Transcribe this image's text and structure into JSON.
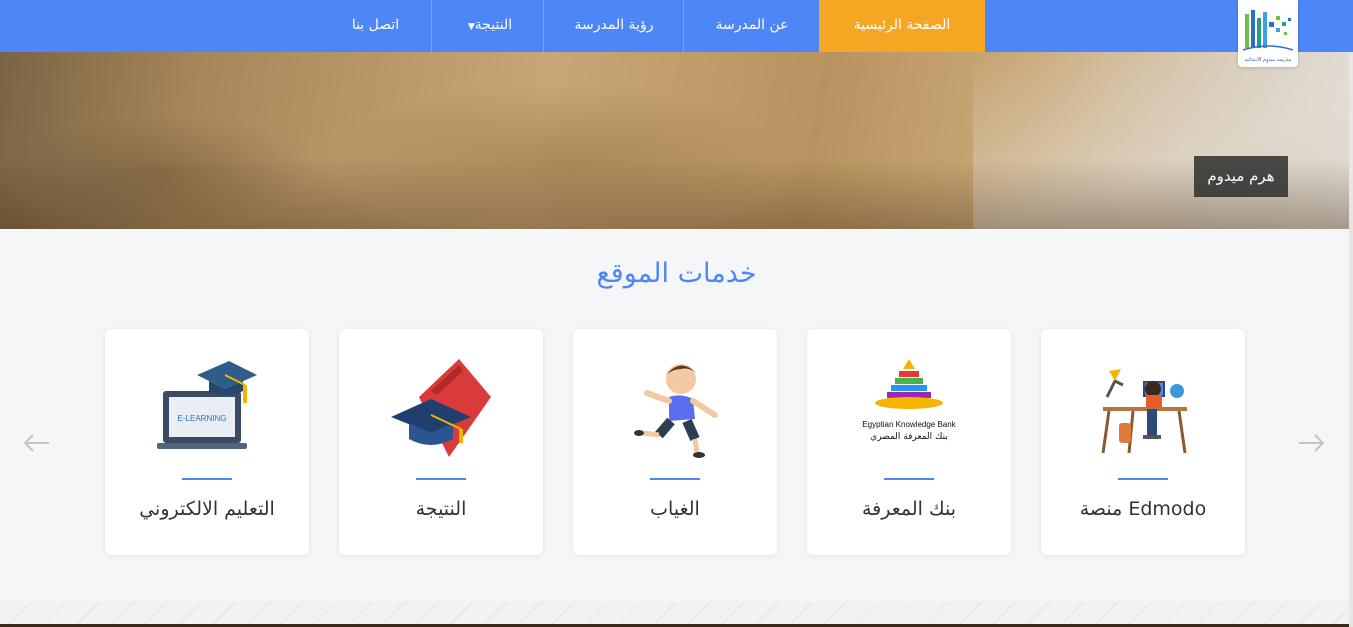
{
  "nav": {
    "items": [
      {
        "label": "الصفحة الرئيسية",
        "active": true
      },
      {
        "label": "عن المدرسة"
      },
      {
        "label": "رؤية المدرسة"
      },
      {
        "label": "النتيجة",
        "has_dropdown": true
      },
      {
        "label": "اتصل بنا"
      }
    ],
    "accent_color": "#4d87f7",
    "active_color": "#f5a623"
  },
  "logo": {
    "text": "مدرسة ميدوم الابتدائية"
  },
  "hero": {
    "caption": "هرم ميدوم"
  },
  "services": {
    "title": "خدمات الموقع",
    "cards": [
      {
        "label": "منصة Edmodo",
        "icon": "student-desk-icon"
      },
      {
        "label": "بنك المعرفة",
        "icon": "knowledge-bank-icon",
        "icon_text": [
          "Egyptian Knowledge Bank",
          "بنك المعرفة المصري"
        ]
      },
      {
        "label": "الغياب",
        "icon": "running-boy-icon"
      },
      {
        "label": "النتيجة",
        "icon": "graduation-cap-book-icon"
      },
      {
        "label": "التعليم الالكتروني",
        "icon": "e-learning-laptop-icon",
        "icon_text": [
          "E-LEARNING"
        ]
      }
    ]
  },
  "carousel": {
    "prev_icon": "arrow-left-icon",
    "next_icon": "arrow-right-icon"
  }
}
